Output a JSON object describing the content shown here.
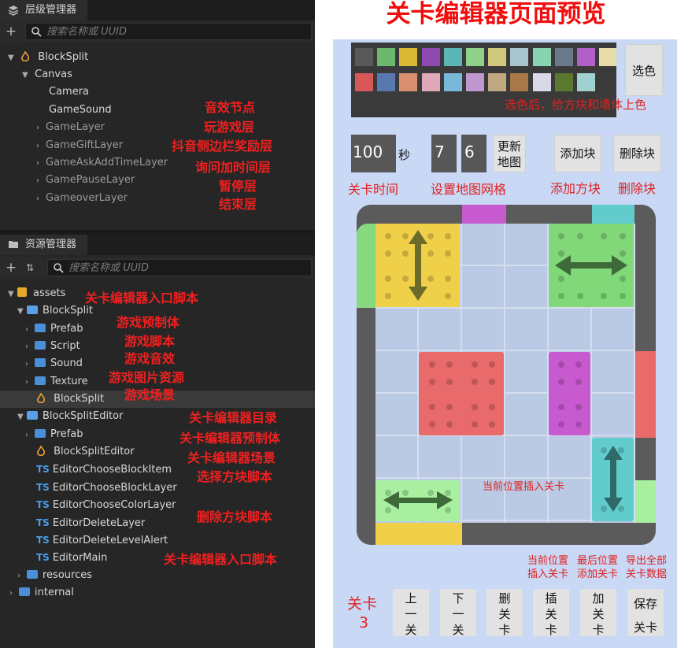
{
  "hierarchy": {
    "tab": "层级管理器",
    "search_placeholder": "搜索名称或 UUID",
    "rows": [
      {
        "label": "BlockSplit"
      },
      {
        "label": "Canvas"
      },
      {
        "label": "Camera"
      },
      {
        "label": "GameSound"
      },
      {
        "label": "GameLayer"
      },
      {
        "label": "GameGiftLayer"
      },
      {
        "label": "GameAskAddTimeLayer"
      },
      {
        "label": "GamePauseLayer"
      },
      {
        "label": "GameoverLayer"
      }
    ],
    "annotations": [
      "音效节点",
      "玩游戏层",
      "抖音侧边栏奖励层",
      "询问加时间层",
      "暂停层",
      "结束层"
    ]
  },
  "assets": {
    "tab": "资源管理器",
    "search_placeholder": "搜索名称或 UUID",
    "rows": [
      {
        "label": "assets"
      },
      {
        "label": "BlockSplit"
      },
      {
        "label": "Prefab"
      },
      {
        "label": "Script"
      },
      {
        "label": "Sound"
      },
      {
        "label": "Texture"
      },
      {
        "label": "BlockSplit"
      },
      {
        "label": "BlockSplitEditor"
      },
      {
        "label": "Prefab"
      },
      {
        "label": "BlockSplitEditor"
      },
      {
        "label": "EditorChooseBlockItem"
      },
      {
        "label": "EditorChooseBlockLayer"
      },
      {
        "label": "EditorChooseColorLayer"
      },
      {
        "label": "EditorDeleteLayer"
      },
      {
        "label": "EditorDeleteLevelAlert"
      },
      {
        "label": "EditorMain"
      },
      {
        "label": "resources"
      },
      {
        "label": "internal"
      }
    ],
    "annotations": [
      "关卡编辑器入口脚本",
      "游戏预制体",
      "游戏脚本",
      "游戏音效",
      "游戏图片资源",
      "游戏场景",
      "关卡编辑器目录",
      "关卡编辑器预制体",
      "关卡编辑器场景",
      "选择方块脚本",
      "删除方块脚本",
      "关卡编辑器入口脚本"
    ],
    "ts_tag": "TS"
  },
  "preview": {
    "title": "关卡编辑器页面预览",
    "select_color_button": "选色",
    "select_color_note": "选色后，给方块和墙体上色",
    "time_value": "100",
    "time_unit": "秒",
    "grid_cols": "7",
    "grid_rows": "6",
    "update_map_button": "更新地图",
    "add_block_button": "添加块",
    "delete_block_button": "删除块",
    "level_time_label": "关卡时间",
    "set_grid_label": "设置地图网格",
    "add_block_label": "添加方块",
    "delete_block_label": "删除块",
    "board_note": "当前位置插入关卡",
    "note_insert": "当前位置插入关卡",
    "note_append": "最后位置添加关卡",
    "note_export": "导出全部关卡数据",
    "level_label": "关卡",
    "level_number": "3",
    "btn_prev": "上一关",
    "btn_next": "下一关",
    "btn_delete": "删关卡",
    "btn_insert": "插关卡",
    "btn_add": "加关卡",
    "btn_save": "保存关卡",
    "palette_colors": [
      "#595959",
      "#6cb86c",
      "#d8b834",
      "#8e4ab0",
      "#5cb6b6",
      "#8fd08a",
      "#cfc87a",
      "#a8c4cc",
      "#88d4b0",
      "#6a7a8c",
      "#b060c8",
      "#e8dca8",
      "#d85858",
      "#5a78b0",
      "#d89070",
      "#e0a8b8",
      "#78b8d8",
      "#c098d0",
      "#c0a880",
      "#a87848",
      "#d8d8e8",
      "#5a7830",
      "#a0d0d0"
    ],
    "colors": {
      "accent_red": "#e02222",
      "board_bg": "#c9d8f4"
    }
  }
}
